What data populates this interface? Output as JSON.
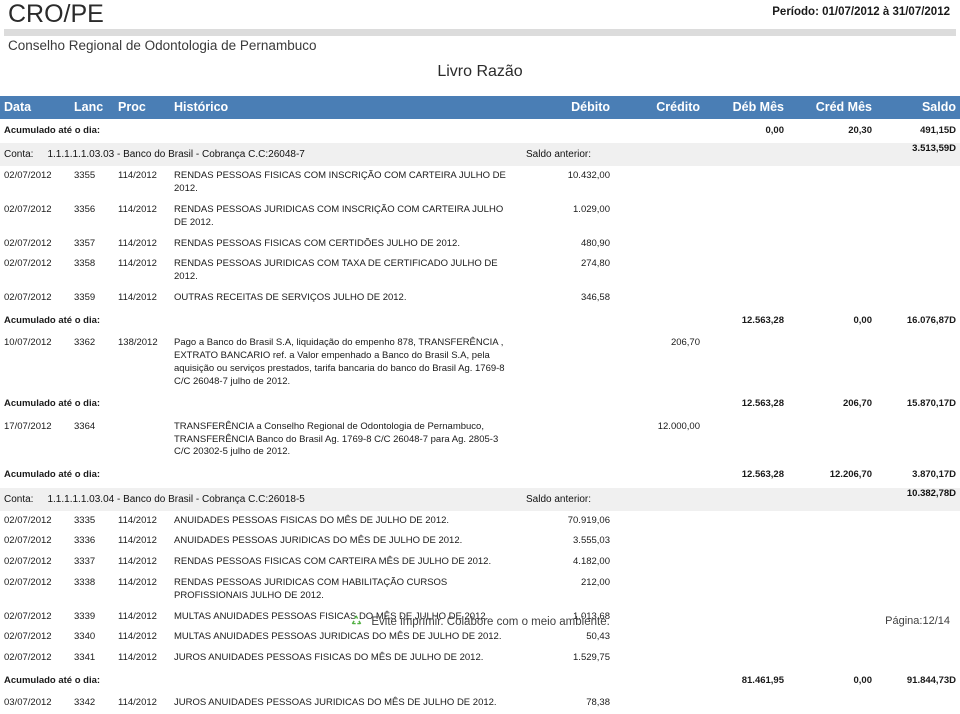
{
  "header": {
    "org_abbr": "CRO/PE",
    "org_name": "Conselho Regional de Odontologia de Pernambuco",
    "period": "Período: 01/07/2012 à 31/07/2012",
    "doc_title": "Livro Razão"
  },
  "columns": {
    "data": "Data",
    "lanc": "Lanc",
    "proc": "Proc",
    "historico": "Histórico",
    "debito": "Débito",
    "credito": "Crédito",
    "deb_mes": "Déb Mês",
    "cred_mes": "Créd Mês",
    "saldo": "Saldo"
  },
  "labels": {
    "accumulated": "Acumulado até o dia:",
    "conta": "Conta:",
    "saldo_anterior": "Saldo anterior:"
  },
  "rows": [
    {
      "kind": "accum",
      "label": "Acumulado até o dia:",
      "debito": "",
      "credito": "",
      "deb_mes": "0,00",
      "cred_mes": "20,30",
      "saldo": "491,15D"
    },
    {
      "kind": "conta",
      "conta_key": "Conta:",
      "conta_value": "1.1.1.1.1.03.03 - Banco do Brasil -  Cobrança C.C:26048-7",
      "saldo_anterior_label": "Saldo anterior:",
      "saldo_anterior": "3.513,59D"
    },
    {
      "kind": "entry",
      "data": "02/07/2012",
      "lanc": "3355",
      "proc": "114/2012",
      "historico": "RENDAS PESSOAS FISICAS COM INSCRIÇÃO COM CARTEIRA JULHO DE 2012.",
      "debito": "10.432,00",
      "credito": "",
      "deb_mes": "",
      "cred_mes": "",
      "saldo": ""
    },
    {
      "kind": "entry",
      "data": "02/07/2012",
      "lanc": "3356",
      "proc": "114/2012",
      "historico": "RENDAS PESSOAS JURIDICAS COM INSCRIÇÃO COM CARTEIRA JULHO DE 2012.",
      "debito": "1.029,00",
      "credito": "",
      "deb_mes": "",
      "cred_mes": "",
      "saldo": ""
    },
    {
      "kind": "entry",
      "data": "02/07/2012",
      "lanc": "3357",
      "proc": "114/2012",
      "historico": "RENDAS PESSOAS FISICAS COM CERTIDÕES JULHO DE 2012.",
      "debito": "480,90",
      "credito": "",
      "deb_mes": "",
      "cred_mes": "",
      "saldo": ""
    },
    {
      "kind": "entry",
      "data": "02/07/2012",
      "lanc": "3358",
      "proc": "114/2012",
      "historico": "RENDAS PESSOAS JURIDICAS COM TAXA DE CERTIFICADO JULHO DE 2012.",
      "debito": "274,80",
      "credito": "",
      "deb_mes": "",
      "cred_mes": "",
      "saldo": ""
    },
    {
      "kind": "entry",
      "data": "02/07/2012",
      "lanc": "3359",
      "proc": "114/2012",
      "historico": "OUTRAS RECEITAS DE SERVIÇOS JULHO DE 2012.",
      "debito": "346,58",
      "credito": "",
      "deb_mes": "",
      "cred_mes": "",
      "saldo": ""
    },
    {
      "kind": "accum",
      "label": "Acumulado até o dia:",
      "debito": "",
      "credito": "",
      "deb_mes": "12.563,28",
      "cred_mes": "0,00",
      "saldo": "16.076,87D"
    },
    {
      "kind": "entry",
      "data": "10/07/2012",
      "lanc": "3362",
      "proc": "138/2012",
      "historico": "Pago a Banco do Brasil S.A, liquidação  do empenho 878, TRANSFERÊNCIA , EXTRATO BANCARIO  ref. a Valor empenhado a Banco do Brasil S.A, pela aquisição ou serviços prestados, tarifa bancaria do banco do Brasil Ag. 1769-8  C/C 26048-7 julho de 2012.",
      "debito": "",
      "credito": "206,70",
      "deb_mes": "",
      "cred_mes": "",
      "saldo": ""
    },
    {
      "kind": "accum",
      "label": "Acumulado até o dia:",
      "debito": "",
      "credito": "",
      "deb_mes": "12.563,28",
      "cred_mes": "206,70",
      "saldo": "15.870,17D"
    },
    {
      "kind": "entry",
      "data": "17/07/2012",
      "lanc": "3364",
      "proc": "",
      "historico": "TRANSFERÊNCIA a Conselho Regional de Odontologia de Pernambuco, TRANSFERÊNCIA Banco do Brasil Ag. 1769-8 C/C 26048-7 para Ag. 2805-3 C/C 20302-5 julho de 2012.",
      "debito": "",
      "credito": "12.000,00",
      "deb_mes": "",
      "cred_mes": "",
      "saldo": ""
    },
    {
      "kind": "accum",
      "label": "Acumulado até o dia:",
      "debito": "",
      "credito": "",
      "deb_mes": "12.563,28",
      "cred_mes": "12.206,70",
      "saldo": "3.870,17D"
    },
    {
      "kind": "conta",
      "conta_key": "Conta:",
      "conta_value": "1.1.1.1.1.03.04 - Banco do Brasil - Cobrança C.C:26018-5",
      "saldo_anterior_label": "Saldo anterior:",
      "saldo_anterior": "10.382,78D"
    },
    {
      "kind": "entry",
      "data": "02/07/2012",
      "lanc": "3335",
      "proc": "114/2012",
      "historico": "ANUIDADES PESSOAS FISICAS DO MÊS DE JULHO DE 2012.",
      "debito": "70.919,06",
      "credito": "",
      "deb_mes": "",
      "cred_mes": "",
      "saldo": ""
    },
    {
      "kind": "entry",
      "data": "02/07/2012",
      "lanc": "3336",
      "proc": "114/2012",
      "historico": "ANUIDADES PESSOAS JURIDICAS DO MÊS DE JULHO DE 2012.",
      "debito": "3.555,03",
      "credito": "",
      "deb_mes": "",
      "cred_mes": "",
      "saldo": ""
    },
    {
      "kind": "entry",
      "data": "02/07/2012",
      "lanc": "3337",
      "proc": "114/2012",
      "historico": "RENDAS PESSOAS FISICAS COM CARTEIRA MÊS DE JULHO DE 2012.",
      "debito": "4.182,00",
      "credito": "",
      "deb_mes": "",
      "cred_mes": "",
      "saldo": ""
    },
    {
      "kind": "entry",
      "data": "02/07/2012",
      "lanc": "3338",
      "proc": "114/2012",
      "historico": "RENDAS PESSOAS JURIDICAS COM HABILITAÇÃO CURSOS PROFISSIONAIS JULHO DE 2012.",
      "debito": "212,00",
      "credito": "",
      "deb_mes": "",
      "cred_mes": "",
      "saldo": ""
    },
    {
      "kind": "entry",
      "data": "02/07/2012",
      "lanc": "3339",
      "proc": "114/2012",
      "historico": "MULTAS ANUIDADES PESSOAS FISICAS DO MÊS DE JULHO DE 2012.",
      "debito": "1.013,68",
      "credito": "",
      "deb_mes": "",
      "cred_mes": "",
      "saldo": ""
    },
    {
      "kind": "entry",
      "data": "02/07/2012",
      "lanc": "3340",
      "proc": "114/2012",
      "historico": "MULTAS ANUIDADES PESSOAS JURIDICAS DO MÊS DE JULHO DE 2012.",
      "debito": "50,43",
      "credito": "",
      "deb_mes": "",
      "cred_mes": "",
      "saldo": ""
    },
    {
      "kind": "entry",
      "data": "02/07/2012",
      "lanc": "3341",
      "proc": "114/2012",
      "historico": "JUROS ANUIDADES PESSOAS FISICAS DO MÊS DE JULHO DE 2012.",
      "debito": "1.529,75",
      "credito": "",
      "deb_mes": "",
      "cred_mes": "",
      "saldo": ""
    },
    {
      "kind": "accum",
      "label": "Acumulado até o dia:",
      "debito": "",
      "credito": "",
      "deb_mes": "81.461,95",
      "cred_mes": "0,00",
      "saldo": "91.844,73D"
    },
    {
      "kind": "entry",
      "data": "03/07/2012",
      "lanc": "3342",
      "proc": "114/2012",
      "historico": "JUROS ANUIDADES PESSOAS JURIDICAS DO MÊS DE JULHO DE 2012.",
      "debito": "78,38",
      "credito": "",
      "deb_mes": "",
      "cred_mes": "",
      "saldo": ""
    }
  ],
  "footer": {
    "icon": "recycle-icon",
    "message": "Evite imprimir. Colabore com o meio ambiente.",
    "page": "Página:12/14"
  },
  "colors": {
    "header_blue": "#4a7eb5",
    "band_grey": "#dcdcdc",
    "conta_row_grey": "#f0f0f0",
    "recycle_green": "#52b043"
  }
}
